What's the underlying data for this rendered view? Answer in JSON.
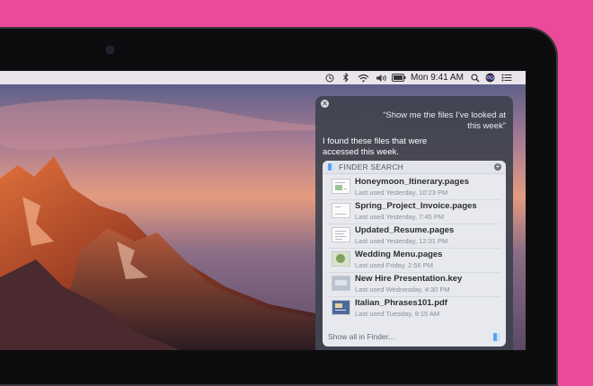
{
  "menubar": {
    "clock": "Mon 9:41 AM",
    "icons": [
      "time-machine-icon",
      "bluetooth-icon",
      "wifi-icon",
      "volume-icon",
      "battery-icon",
      "spotlight-search-icon",
      "siri-icon",
      "notification-center-icon"
    ]
  },
  "siri": {
    "query": "“Show me the files I’ve looked at this week”",
    "reply": "I found these files that were accessed this week."
  },
  "finder_card": {
    "title": "FINDER SEARCH",
    "footer": "Show all in Finder...",
    "files": [
      {
        "name": "Honeymoon_Itinerary.pages",
        "meta": "Last used Yesterday, 10:23 PM",
        "thumb": "doc-map"
      },
      {
        "name": "Spring_Project_Invoice.pages",
        "meta": "Last used Yesterday, 7:45 PM",
        "thumb": "doc-plain"
      },
      {
        "name": "Updated_Resume.pages",
        "meta": "Last used Yesterday, 12:31 PM",
        "thumb": "doc-lines"
      },
      {
        "name": "Wedding Menu.pages",
        "meta": "Last used Friday, 2:56 PM",
        "thumb": "doc-photo"
      },
      {
        "name": "New Hire Presentation.key",
        "meta": "Last used Wednesday, 4:30 PM",
        "thumb": "slide"
      },
      {
        "name": "Italian_Phrases101.pdf",
        "meta": "Last used Tuesday, 9:15 AM",
        "thumb": "pdf"
      }
    ]
  },
  "colors": {
    "background": "#ea4a99",
    "siri_panel": "#3e424e",
    "card": "#eceef4"
  }
}
